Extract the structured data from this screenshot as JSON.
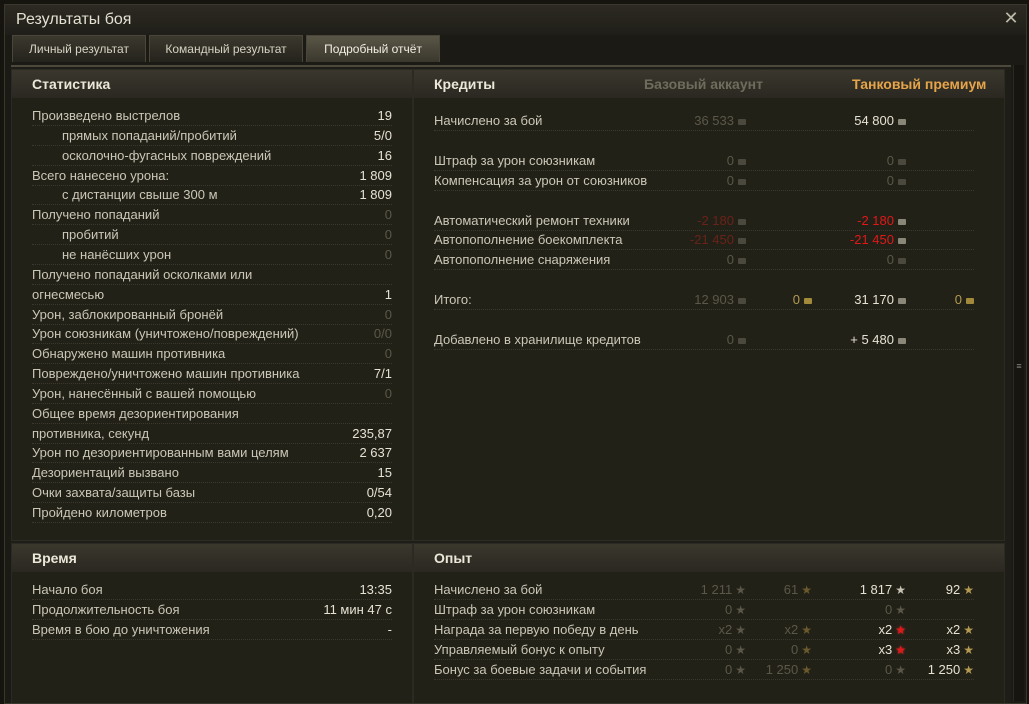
{
  "window": {
    "title": "Результаты боя"
  },
  "tabs": [
    {
      "label": "Личный результат"
    },
    {
      "label": "Командный результат"
    },
    {
      "label": "Подробный отчёт"
    }
  ],
  "stats": {
    "title": "Статистика",
    "rows": [
      {
        "label": "Произведено выстрелов",
        "value": "19"
      },
      {
        "label": "прямых попаданий/пробитий",
        "value": "5/0"
      },
      {
        "label": "осколочно-фугасных повреждений",
        "value": "16"
      },
      {
        "label": "Всего нанесено урона:",
        "value": "1 809"
      },
      {
        "label": "с дистанции свыше 300 м",
        "value": "1 809"
      },
      {
        "label": "Получено попаданий",
        "value": "0"
      },
      {
        "label": "пробитий",
        "value": "0"
      },
      {
        "label": "не нанёсших урон",
        "value": "0"
      },
      {
        "label": "Получено попаданий осколками или",
        "value": ""
      },
      {
        "label": "огнесмесью",
        "value": "1"
      },
      {
        "label": "Урон, заблокированный бронёй",
        "value": "0"
      },
      {
        "label": "Урон союзникам (уничтожено/повреждений)",
        "value": "0/0"
      },
      {
        "label": "Обнаружено машин противника",
        "value": "0"
      },
      {
        "label": "Повреждено/уничтожено машин противника",
        "value": "7/1"
      },
      {
        "label": "Урон, нанесённый с вашей помощью",
        "value": "0"
      },
      {
        "label": "Общее время дезориентирования",
        "value": ""
      },
      {
        "label": "противника, секунд",
        "value": "235,87"
      },
      {
        "label": "Урон по дезориентированным вами целям",
        "value": "2 637"
      },
      {
        "label": "Дезориентаций вызвано",
        "value": "15"
      },
      {
        "label": "Очки захвата/защиты базы",
        "value": "0/54"
      },
      {
        "label": "Пройдено километров",
        "value": "0,20"
      }
    ]
  },
  "credits": {
    "title": "Кредиты",
    "col_base": "Базовый аккаунт",
    "col_premium": "Танковый премиум",
    "rows": [
      {
        "label": "Начислено за бой",
        "base": "36 533",
        "prem": "54 800"
      },
      {
        "label": "Штраф за урон союзникам",
        "base": "0",
        "prem": "0"
      },
      {
        "label": "Компенсация за урон от союзников",
        "base": "0",
        "prem": "0"
      },
      {
        "label": "Автоматический ремонт техники",
        "base": "-2 180",
        "prem": "-2 180"
      },
      {
        "label": "Автопополнение боекомплекта",
        "base": "-21 450",
        "prem": "-21 450"
      },
      {
        "label": "Автопополнение снаряжения",
        "base": "0",
        "prem": "0"
      },
      {
        "label": "Итого:",
        "base": "12 903",
        "base2": "0",
        "prem": "31 170",
        "prem2": "0"
      },
      {
        "label": "Добавлено в хранилище кредитов",
        "base": "0",
        "prem": "+ 5 480"
      }
    ]
  },
  "time": {
    "title": "Время",
    "rows": [
      {
        "label": "Начало боя",
        "value": "13:35"
      },
      {
        "label": "Продолжительность боя",
        "value": "11 мин 47 с"
      },
      {
        "label": "Время в бою до уничтожения",
        "value": "-"
      }
    ]
  },
  "exp": {
    "title": "Опыт",
    "rows": [
      {
        "label": "Начислено за бой",
        "b1": "1 211",
        "b2": "61",
        "p1": "1 817",
        "p2": "92"
      },
      {
        "label": "Штраф за урон союзникам",
        "b1": "0",
        "b2": "",
        "p1": "0",
        "p2": ""
      },
      {
        "label": "Награда за первую победу в день",
        "b1": "x2",
        "b2": "x2",
        "p1": "x2",
        "p2": "x2"
      },
      {
        "label": "Управляемый бонус к опыту",
        "b1": "0",
        "b2": "0",
        "p1": "x3",
        "p2": "x3"
      },
      {
        "label": "Бонус за боевые задачи и события",
        "b1": "0",
        "b2": "1 250",
        "p1": "0",
        "p2": "1 250"
      }
    ]
  }
}
